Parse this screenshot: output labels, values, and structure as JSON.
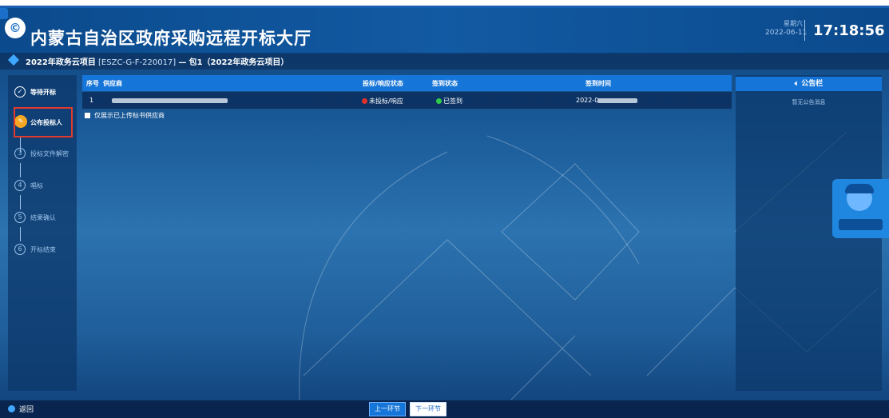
{
  "header": {
    "logo_glyph": "©",
    "title": "内蒙古自治区政府采购远程开标大厅",
    "weekday": "星期六",
    "date": "2022-06-11",
    "time": "17:18:56"
  },
  "project": {
    "name": "2022年政务云项目",
    "code": "[ESZC-G-F-220017]",
    "separator": "—",
    "package": "包1（2022年政务云项目）"
  },
  "steps": [
    {
      "num": "✓",
      "label": "等待开标",
      "state": "done"
    },
    {
      "num": "✎",
      "label": "公布投标人",
      "state": "active"
    },
    {
      "num": "3",
      "label": "投标文件解密",
      "state": "pending"
    },
    {
      "num": "4",
      "label": "唱标",
      "state": "pending"
    },
    {
      "num": "5",
      "label": "结果确认",
      "state": "pending"
    },
    {
      "num": "6",
      "label": "开标结束",
      "state": "pending"
    }
  ],
  "table": {
    "headers": [
      "序号",
      "供应商",
      "投标/响应状态",
      "签到状态",
      "签到时间"
    ],
    "rows": [
      {
        "index": "1",
        "bid_status": "未投标/响应",
        "signin_status": "已签到",
        "signin_time": "2022-0"
      }
    ],
    "filter_label": "仅展示已上传标书供应商"
  },
  "announcement": {
    "title": "公告栏",
    "icon": "speaker-icon",
    "empty": "暂无公告消息"
  },
  "footer": {
    "back": "返回",
    "prev": "上一环节",
    "next": "下一环节"
  },
  "colors": {
    "accent": "#1575d8",
    "active_step": "#f5a623",
    "highlight": "#e33a2e",
    "status_red": "#e0312b",
    "status_green": "#2ecc4b"
  }
}
